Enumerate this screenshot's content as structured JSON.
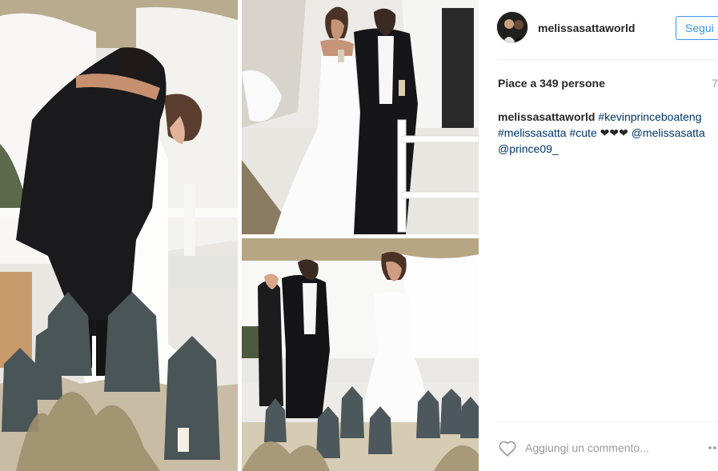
{
  "post": {
    "username": "melissasattaworld",
    "follow_label": "Segui",
    "likes_text": "Piace a 349 persone",
    "age_text": "7",
    "caption": {
      "author": "melissasattaworld",
      "tags_line1": "#kevinprinceboateng",
      "tags_line2a": "#melissasatta #cute",
      "hearts": "❤❤❤",
      "mention1": "@melissasatta",
      "mention2": "@prince09_"
    },
    "comment_placeholder": "Aggiungi un commento...",
    "icons": {
      "like": "heart-icon",
      "more": "more-options-icon"
    }
  },
  "colors": {
    "accent": "#3897f0",
    "link": "#003569",
    "muted": "#999999",
    "divider": "#efefef"
  }
}
